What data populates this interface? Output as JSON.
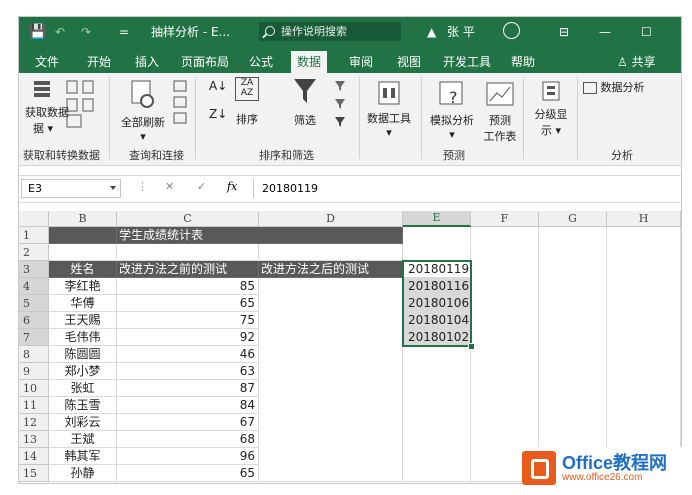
{
  "titlebar": {
    "save_icon": "save-icon",
    "doc_title": "抽样分析 - E...",
    "search_placeholder": "操作说明搜索",
    "user_name": "张 平",
    "warning_icon": "warning-icon",
    "minimize": "—",
    "maximize": "☐"
  },
  "tabs": [
    "文件",
    "开始",
    "插入",
    "页面布局",
    "公式",
    "数据",
    "审阅",
    "视图",
    "开发工具",
    "帮助"
  ],
  "active_tab": "数据",
  "share_label": "共享",
  "ribbon": {
    "get_data_label": "获取数据",
    "get_data_line2": "据 ▾",
    "refresh_all_label": "全部刷新",
    "sort_label": "排序",
    "filter_label": "筛选",
    "data_tools_label": "数据工具",
    "what_if_label": "模拟分析",
    "forecast_label": "预测",
    "forecast_sheet_line2": "工作表",
    "outline_label": "分级显",
    "outline_line2": "示 ▾",
    "data_analysis_label": "数据分析",
    "groups": [
      "获取和转换数据",
      "查询和连接",
      "排序和筛选",
      "预测",
      "分析"
    ]
  },
  "formula_bar": {
    "name_box": "E3",
    "cancel": "✕",
    "enter": "✓",
    "fx": "fx",
    "value": "20180119"
  },
  "sheet": {
    "columns": [
      "B",
      "C",
      "D",
      "E",
      "F",
      "G",
      "H"
    ],
    "selected_column": "E",
    "rows": [
      "1",
      "2",
      "3",
      "4",
      "5",
      "6",
      "7",
      "8",
      "9",
      "10",
      "11",
      "12",
      "13",
      "14",
      "15"
    ],
    "title": "学生成绩统计表",
    "headers": {
      "name": "姓名",
      "before": "改进方法之前的测试",
      "after": "改进方法之后的测试"
    },
    "students": [
      {
        "name": "李红艳",
        "score": "85"
      },
      {
        "name": "华傅",
        "score": "65"
      },
      {
        "name": "王天赐",
        "score": "75"
      },
      {
        "name": "毛伟伟",
        "score": "92"
      },
      {
        "name": "陈圆圆",
        "score": "46"
      },
      {
        "name": "郑小梦",
        "score": "63"
      },
      {
        "name": "张虹",
        "score": "87"
      },
      {
        "name": "陈玉雪",
        "score": "84"
      },
      {
        "name": "刘彩云",
        "score": "67"
      },
      {
        "name": "王斌",
        "score": "68"
      },
      {
        "name": "韩其军",
        "score": "96"
      },
      {
        "name": "孙静",
        "score": "65"
      }
    ],
    "e_values": [
      "20180119",
      "20180116",
      "20180106",
      "20180104",
      "20180102"
    ]
  },
  "watermark": {
    "title": "Office教程网",
    "url": "www.office26.com"
  }
}
